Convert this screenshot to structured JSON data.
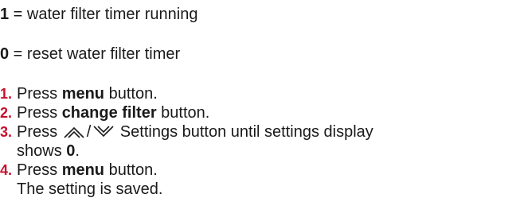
{
  "states": [
    {
      "value": "1",
      "separator": " = ",
      "description": "water filter timer running"
    },
    {
      "value": "0",
      "separator": " = ",
      "description": "reset water filter timer"
    }
  ],
  "steps": [
    {
      "number": "1.",
      "prefix": "Press ",
      "bold": "menu",
      "suffix": " button."
    },
    {
      "number": "2.",
      "prefix": "Press ",
      "bold": "change filter",
      "suffix": " button."
    },
    {
      "number": "3.",
      "prefix": "Press ",
      "icons": [
        "chevron-up-icon",
        "chevron-down-icon"
      ],
      "slash": "/",
      "middle": " Settings button until settings display",
      "line2_prefix": "shows ",
      "line2_bold": "0",
      "line2_suffix": "."
    },
    {
      "number": "4.",
      "prefix": "Press ",
      "bold": "menu",
      "suffix": " button.",
      "line2": "The setting is saved."
    }
  ],
  "colors": {
    "step_number": "#c8102e",
    "text": "#1a1a1a"
  }
}
